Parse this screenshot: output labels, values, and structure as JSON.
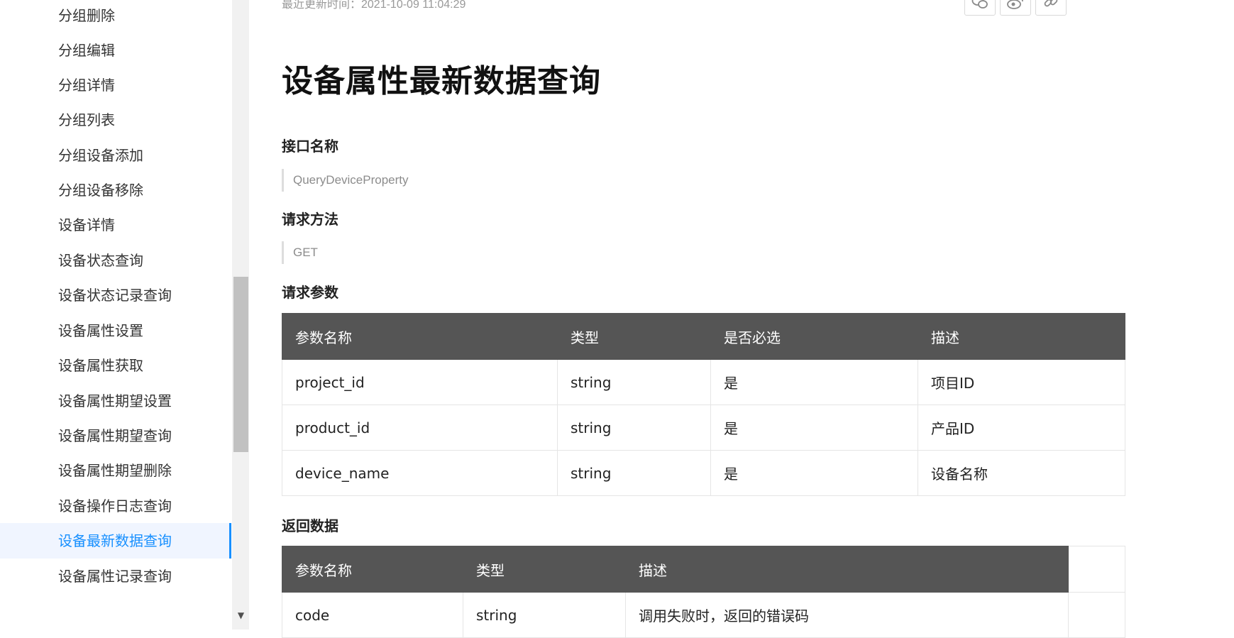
{
  "sidebar": {
    "items": [
      {
        "label": "分组删除"
      },
      {
        "label": "分组编辑"
      },
      {
        "label": "分组详情"
      },
      {
        "label": "分组列表"
      },
      {
        "label": "分组设备添加"
      },
      {
        "label": "分组设备移除"
      },
      {
        "label": "设备详情"
      },
      {
        "label": "设备状态查询"
      },
      {
        "label": "设备状态记录查询"
      },
      {
        "label": "设备属性设置"
      },
      {
        "label": "设备属性获取"
      },
      {
        "label": "设备属性期望设置"
      },
      {
        "label": "设备属性期望查询"
      },
      {
        "label": "设备属性期望删除"
      },
      {
        "label": "设备操作日志查询"
      },
      {
        "label": "设备最新数据查询",
        "active": true
      },
      {
        "label": "设备属性记录查询"
      }
    ]
  },
  "header": {
    "update_time": "最近更新时间：2021-10-09 11:04:29",
    "share_icons": [
      "wechat-icon",
      "weibo-icon",
      "link-icon"
    ]
  },
  "article": {
    "title": "设备属性最新数据查询",
    "api_name_heading": "接口名称",
    "api_name": "QueryDeviceProperty",
    "method_heading": "请求方法",
    "method": "GET",
    "params_heading": "请求参数",
    "params_table": {
      "headers": [
        "参数名称",
        "类型",
        "是否必选",
        "描述"
      ],
      "rows": [
        [
          "project_id",
          "string",
          "是",
          "项目ID"
        ],
        [
          "product_id",
          "string",
          "是",
          "产品ID"
        ],
        [
          "device_name",
          "string",
          "是",
          "设备名称"
        ]
      ]
    },
    "response_heading": "返回数据",
    "response_table": {
      "headers": [
        "参数名称",
        "类型",
        "描述"
      ],
      "rows": [
        [
          "code",
          "string",
          "调用失败时，返回的错误码"
        ]
      ]
    }
  },
  "colors": {
    "accent": "#1890ff",
    "table_header_bg": "#555555",
    "active_item_bg": "#f0f5ff"
  }
}
